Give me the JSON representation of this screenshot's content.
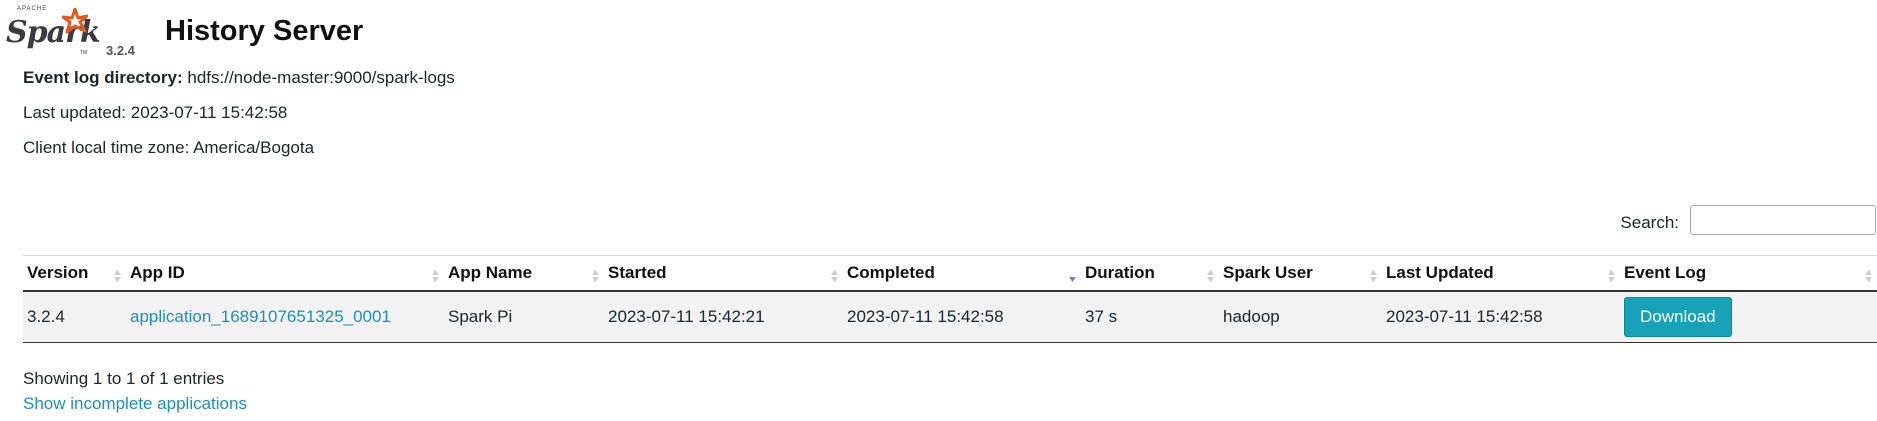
{
  "header": {
    "logo_top_text": "APACHE",
    "logo_text": "Spark",
    "logo_tm": "TM",
    "version": "3.2.4",
    "title": "History Server",
    "logo_color": "#e25a1c"
  },
  "info": {
    "event_log_label": "Event log directory:",
    "event_log_value": "hdfs://node-master:9000/spark-logs",
    "last_updated": "Last updated: 2023-07-11 15:42:58",
    "timezone": "Client local time zone: America/Bogota"
  },
  "search": {
    "label": "Search:",
    "value": "",
    "placeholder": ""
  },
  "table": {
    "columns": [
      "Version",
      "App ID",
      "App Name",
      "Started",
      "Completed",
      "Duration",
      "Spark User",
      "Last Updated",
      "Event Log"
    ],
    "sorted_column": "Completed",
    "sort_direction": "descending",
    "rows": [
      {
        "version": "3.2.4",
        "app_id": "application_1689107651325_0001",
        "app_name": "Spark Pi",
        "started": "2023-07-11 15:42:21",
        "completed": "2023-07-11 15:42:58",
        "duration": "37 s",
        "spark_user": "hadoop",
        "last_updated": "2023-07-11 15:42:58",
        "event_log": "Download"
      }
    ]
  },
  "footer": {
    "showing": "Showing 1 to 1 of 1 entries",
    "incomplete_link": "Show incomplete applications"
  },
  "colors": {
    "accent_link": "#1a8fc2",
    "button_bg": "#17a2b8"
  }
}
